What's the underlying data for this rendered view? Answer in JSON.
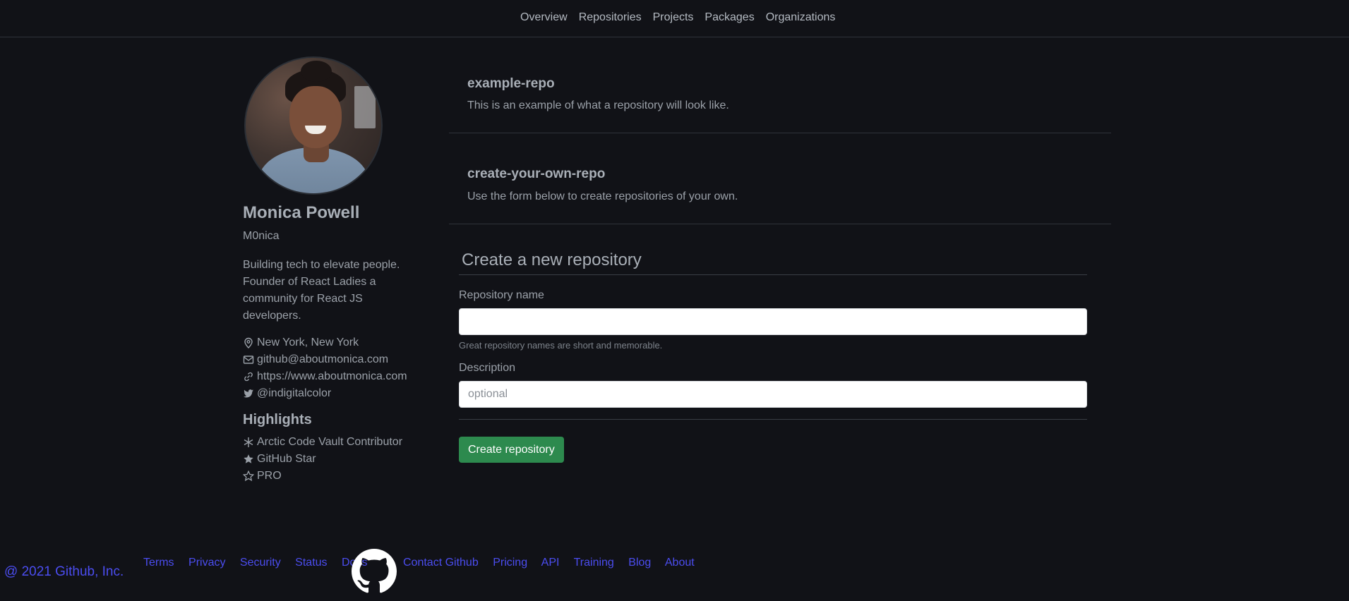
{
  "nav": {
    "items": [
      "Overview",
      "Repositories",
      "Projects",
      "Packages",
      "Organizations"
    ]
  },
  "profile": {
    "name": "Monica Powell",
    "username": "M0nica",
    "bio": "Building tech to elevate people. Founder of React Ladies a community for React JS developers.",
    "location": "New York, New York",
    "email": "github@aboutmonica.com",
    "website": "https://www.aboutmonica.com",
    "twitter": "@indigitalcolor"
  },
  "highlights": {
    "title": "Highlights",
    "items": [
      "Arctic Code Vault Contributor",
      "GitHub Star",
      "PRO"
    ]
  },
  "repos": [
    {
      "name": "example-repo",
      "description": "This is an example of what a repository will look like."
    },
    {
      "name": "create-your-own-repo",
      "description": "Use the form below to create repositories of your own."
    }
  ],
  "form": {
    "title": "Create a new repository",
    "name_label": "Repository name",
    "name_value": "",
    "name_hint": "Great repository names are short and memorable.",
    "description_label": "Description",
    "description_placeholder": "optional",
    "submit_label": "Create repository"
  },
  "footer": {
    "copyright": "@ 2021 Github, Inc.",
    "left_links": [
      "Terms",
      "Privacy",
      "Security",
      "Status",
      "Docs"
    ],
    "right_links": [
      "Contact Github",
      "Pricing",
      "API",
      "Training",
      "Blog",
      "About"
    ]
  },
  "colors": {
    "background": "#111217",
    "accent_button": "#2d8a4e",
    "footer_link": "#4b4df0"
  }
}
